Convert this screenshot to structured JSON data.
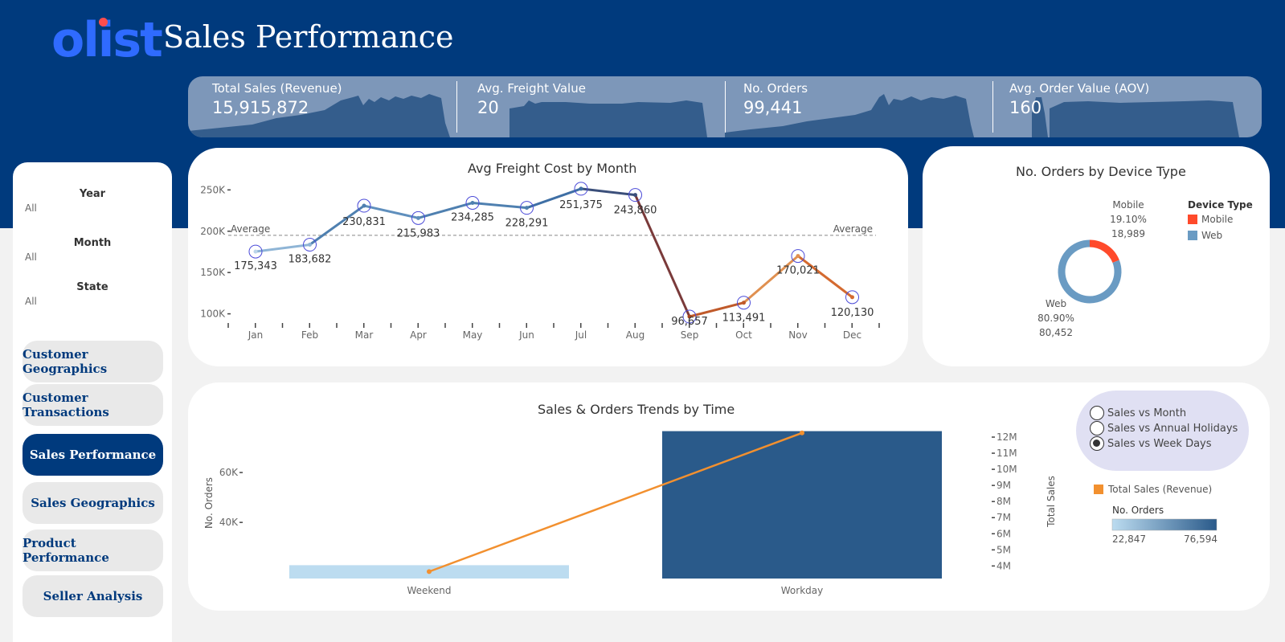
{
  "header": {
    "logo_text": "olist",
    "title": "Sales Performance",
    "bg_color": "#003a7d"
  },
  "kpis": [
    {
      "label": "Total Sales (Revenue)",
      "value": "15,915,872"
    },
    {
      "label": "Avg. Freight Value",
      "value": "20"
    },
    {
      "label": "No. Orders",
      "value": "99,441"
    },
    {
      "label": "Avg. Order Value (AOV)",
      "value": "160"
    }
  ],
  "filters": [
    {
      "title": "Year",
      "value": "All"
    },
    {
      "title": "Month",
      "value": "All"
    },
    {
      "title": "State",
      "value": "All"
    }
  ],
  "nav": [
    {
      "label": "Customer Geographics",
      "active": false
    },
    {
      "label": "Customer Transactions",
      "active": false
    },
    {
      "label": "Sales Performance",
      "active": true
    },
    {
      "label": "Sales  Geographics",
      "active": false
    },
    {
      "label": "Product Performance",
      "active": false
    },
    {
      "label": "Seller Analysis",
      "active": false
    }
  ],
  "chart_data": [
    {
      "type": "line",
      "title": "Avg Freight Cost by Month",
      "categories": [
        "Jan",
        "Feb",
        "Mar",
        "Apr",
        "May",
        "Jun",
        "Jul",
        "Aug",
        "Sep",
        "Oct",
        "Nov",
        "Dec"
      ],
      "values": [
        175343,
        183682,
        230831,
        215983,
        234285,
        228291,
        251375,
        243860,
        96657,
        113491,
        170021,
        120130
      ],
      "value_labels": [
        "175,343",
        "183,682",
        "230,831",
        "215,983",
        "234,285",
        "228,291",
        "251,375",
        "243,860",
        "96,657",
        "113,491",
        "170,021",
        "120,130"
      ],
      "y_ticks": [
        "250K",
        "200K",
        "150K",
        "100K"
      ],
      "y_tick_values": [
        250000,
        200000,
        150000,
        100000
      ],
      "ylim": [
        85000,
        262000
      ],
      "reference_line": {
        "label": "Average",
        "value": 195000
      }
    },
    {
      "type": "pie",
      "title": "No. Orders by Device Type",
      "legend_title": "Device Type",
      "slices": [
        {
          "name": "Mobile",
          "percent_label": "19.10%",
          "count_label": "18,989",
          "value": 18989,
          "color": "#ff4a2b"
        },
        {
          "name": "Web",
          "percent_label": "80.90%",
          "count_label": "80,452",
          "value": 80452,
          "color": "#6a9bc3"
        }
      ]
    },
    {
      "type": "bar",
      "title": "Sales & Orders Trends by Time",
      "categories": [
        "Weekend",
        "Workday"
      ],
      "bar_series": {
        "name": "No. Orders",
        "values": [
          22847,
          76594
        ]
      },
      "line_series": {
        "name": "Total Sales (Revenue)",
        "values": [
          3650000,
          12260000
        ]
      },
      "left_axis": {
        "label": "No. Orders",
        "ticks": [
          "60K",
          "40K"
        ],
        "tick_values": [
          60000,
          40000
        ],
        "range": [
          17500,
          80000
        ]
      },
      "right_axis": {
        "label": "Total Sales",
        "ticks": [
          "12M",
          "11M",
          "10M",
          "9M",
          "8M",
          "7M",
          "6M",
          "5M",
          "4M"
        ],
        "tick_values": [
          12000000,
          11000000,
          10000000,
          9000000,
          8000000,
          7000000,
          6000000,
          5000000,
          4000000
        ],
        "range": [
          3220000,
          12000000
        ]
      },
      "color_scale": {
        "title": "No. Orders",
        "min_label": "22,847",
        "max_label": "76,594",
        "min_color": "#bcdcf0",
        "max_color": "#2a5a8a"
      },
      "line_color": "#f2902f"
    }
  ],
  "view_options": [
    {
      "label": "Sales vs Month",
      "selected": false
    },
    {
      "label": "Sales vs Annual Holidays",
      "selected": false
    },
    {
      "label": "Sales vs Week Days",
      "selected": true
    }
  ]
}
